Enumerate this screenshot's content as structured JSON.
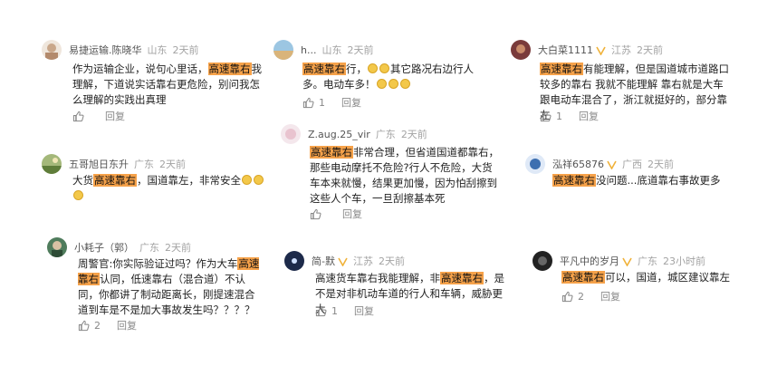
{
  "comments": [
    {
      "user": "易捷运输.陈晓华",
      "location": "山东",
      "time": "2天前",
      "text": [
        "作为运输企业，说句心里话，",
        "高速靠右",
        "我理解，下道说实话靠右更危险，别问我怎么理解的实践出真理"
      ],
      "likes": "",
      "reply": "回复",
      "avatar_color": "#c9a78a"
    },
    {
      "user": "五哥旭日东升",
      "location": "广东",
      "time": "2天前",
      "text": [
        "大货",
        "高速靠右",
        "，国道靠左，非常安全"
      ],
      "likes": "",
      "reply": "回复",
      "avatar_color": "#5f7d3a"
    },
    {
      "user": "小耗子（郭）",
      "location": "广东",
      "time": "2天前",
      "text": [
        "周警官:你实际验证过吗？作为大车",
        "高速靠右",
        "认同，低速靠右（混合道）不认同，你都讲了制动距离长，刚提速混合道到车是不是加大事故发生吗？？？？"
      ],
      "likes": "2",
      "reply": "回复",
      "avatar_color": "#4f7c5c"
    },
    {
      "user": "h...",
      "location": "山东",
      "time": "2天前",
      "text": [
        "高速靠右",
        "行，",
        "其它路况右边行人多。电动车多！"
      ],
      "likes": "1",
      "reply": "回复",
      "avatar_color": "#6aa0c8"
    },
    {
      "user": "Z.aug.25_vir",
      "location": "广东",
      "time": "2天前",
      "text": [
        "高速靠右",
        "非常合理，但省道国道都靠右，那些电动摩托不危险?行人不危险，大货车本来就慢，结果更加慢，因为怕刮擦到这些人个车，一旦刮擦基本死"
      ],
      "likes": "",
      "reply": "回复",
      "avatar_color": "#e9c3cf"
    },
    {
      "user": "简-默",
      "location": "江苏",
      "time": "2天前",
      "text": [
        "高速货车靠右我能理解，非",
        "高速靠右",
        "，是不是对非机动车道的行人和车辆，威胁更大"
      ],
      "likes": "1",
      "reply": "回复",
      "avatar_color": "#1d2a4a"
    },
    {
      "user": "大白菜1111",
      "location": "江苏",
      "time": "2天前",
      "text": [
        "高速靠右",
        "有能理解，但是国道城市道路口较多的靠右 我就不能理解 靠右就是大车跟电动车混合了，浙江就挺好的，部分靠左"
      ],
      "likes": "1",
      "reply": "回复",
      "avatar_color": "#7a3b3b"
    },
    {
      "user": "泓祥65876",
      "location": "广西",
      "time": "2天前",
      "text": [
        "高速靠右",
        "没问题...底道靠右事故更多"
      ],
      "likes": "",
      "reply": "回复",
      "avatar_color": "#3d6fb0"
    },
    {
      "user": "平凡中的岁月",
      "location": "广东",
      "time": "23小时前",
      "text": [
        "高速靠右",
        "可以，国道，城区建议靠左"
      ],
      "likes": "2",
      "reply": "回复",
      "avatar_color": "#222222"
    }
  ]
}
